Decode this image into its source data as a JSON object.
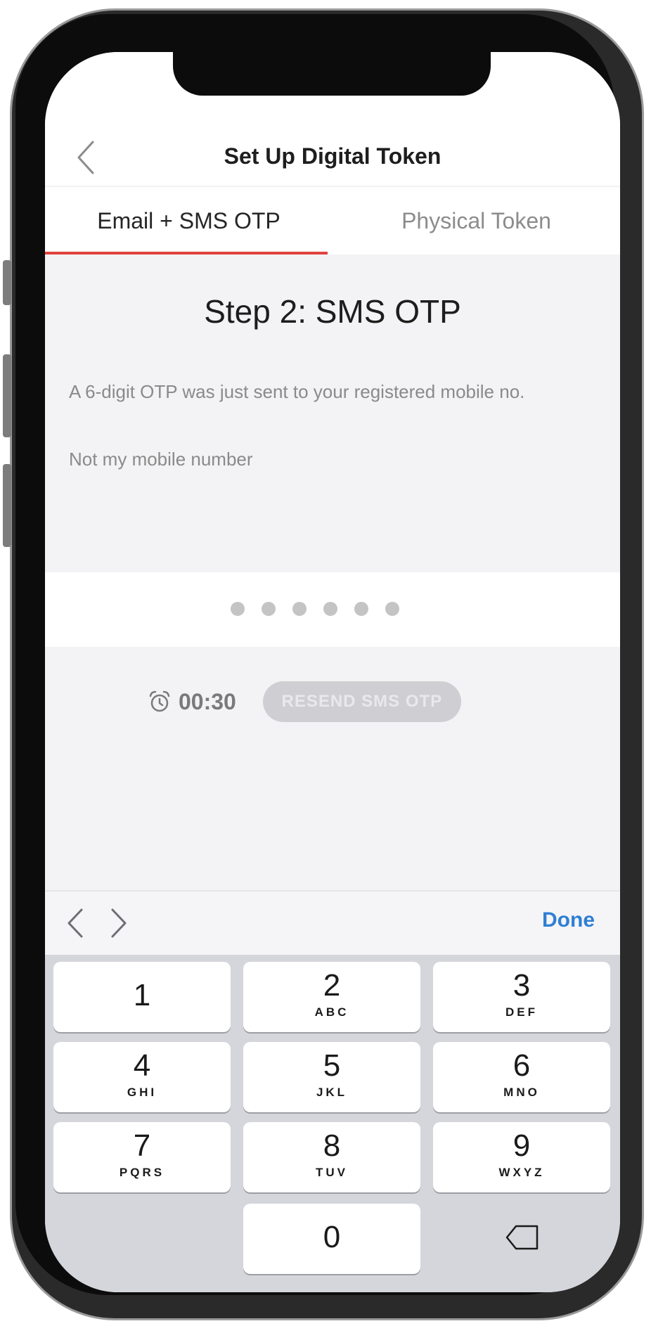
{
  "header": {
    "title": "Set Up Digital Token"
  },
  "tabs": [
    {
      "label": "Email + SMS OTP",
      "active": true
    },
    {
      "label": "Physical Token",
      "active": false
    }
  ],
  "step": {
    "title": "Step 2: SMS OTP",
    "description": "A 6-digit OTP was just sent to your registered mobile no.",
    "change_number_link": "Not my mobile number"
  },
  "otp": {
    "digits_required": 6,
    "digits_entered": 0
  },
  "timer": {
    "countdown": "00:30",
    "resend_label": "RESEND SMS OTP",
    "resend_enabled": false
  },
  "keyboard": {
    "done_label": "Done",
    "keys": [
      {
        "digit": "1",
        "letters": ""
      },
      {
        "digit": "2",
        "letters": "ABC"
      },
      {
        "digit": "3",
        "letters": "DEF"
      },
      {
        "digit": "4",
        "letters": "GHI"
      },
      {
        "digit": "5",
        "letters": "JKL"
      },
      {
        "digit": "6",
        "letters": "MNO"
      },
      {
        "digit": "7",
        "letters": "PQRS"
      },
      {
        "digit": "8",
        "letters": "TUV"
      },
      {
        "digit": "9",
        "letters": "WXYZ"
      },
      {
        "digit": "0",
        "letters": ""
      }
    ]
  },
  "colors": {
    "accent_tab": "#e0433d",
    "done_blue": "#2f7fd4"
  },
  "icons": {
    "back": "chevron-left-icon",
    "alarm": "alarm-clock-icon",
    "prev": "chevron-left-icon",
    "next": "chevron-right-icon",
    "backspace": "backspace-icon"
  }
}
